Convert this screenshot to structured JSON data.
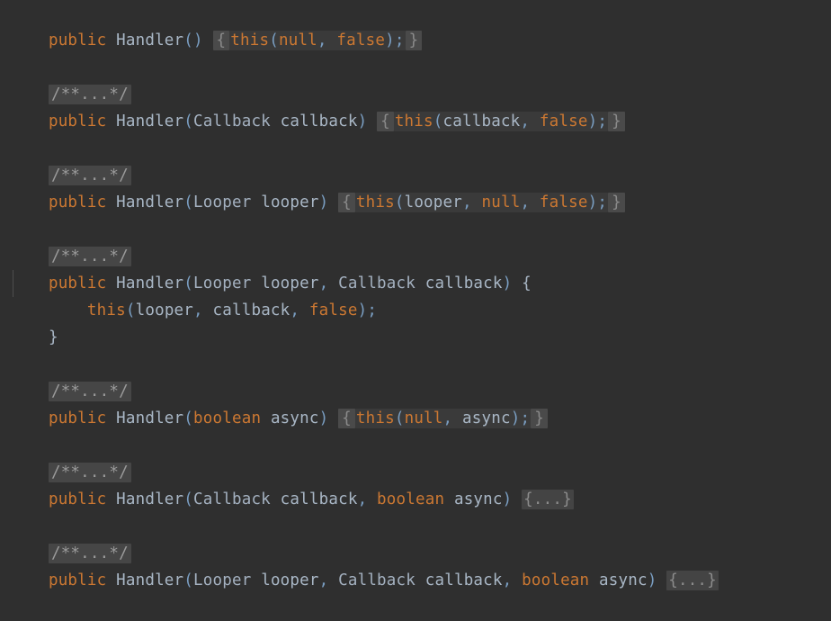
{
  "editor": {
    "language": "java",
    "class_name": "Handler",
    "background_color": "#2f2f2f",
    "colors": {
      "keyword": "#cc7832",
      "identifier": "#a9b7c6",
      "type": "#a4b1c0",
      "punctuation": "#7a9ec2",
      "literal": "#cc7832",
      "fold_background": "#4a4a4a",
      "fold_text": "#8a8a8a",
      "folded_body_background": "#3a3a3a",
      "indent_guide": "#4e4e4e"
    },
    "fold_markers": {
      "javadoc": "/**...*/",
      "body": "{...}",
      "open_brace": "{",
      "close_brace": "}"
    },
    "lines": [
      {
        "n": 1,
        "kind": "code",
        "text": "public Handler() { this(null, false); }",
        "tokens": [
          {
            "t": "public",
            "c": "kw"
          },
          {
            "t": " ",
            "c": "ident"
          },
          {
            "t": "Handler",
            "c": "ident"
          },
          {
            "t": "()",
            "c": "punc"
          },
          {
            "t": " ",
            "c": "ident"
          }
        ],
        "signature": "public Handler()",
        "folded_open": "{",
        "folded_body": "this(null, false);",
        "folded_close": "}"
      },
      {
        "n": 2,
        "kind": "blank",
        "text": ""
      },
      {
        "n": 3,
        "kind": "javadoc-fold",
        "text": "/**...*/"
      },
      {
        "n": 4,
        "kind": "code",
        "text": "public Handler(Callback callback) { this(callback, false); }",
        "signature": "public Handler(Callback callback)",
        "folded_open": "{",
        "folded_body": "this(callback, false);",
        "folded_close": "}"
      },
      {
        "n": 5,
        "kind": "blank",
        "text": ""
      },
      {
        "n": 6,
        "kind": "javadoc-fold",
        "text": "/**...*/"
      },
      {
        "n": 7,
        "kind": "code",
        "text": "public Handler(Looper looper) { this(looper, null, false); }",
        "signature": "public Handler(Looper looper)",
        "folded_open": "{",
        "folded_body": "this(looper, null, false);",
        "folded_close": "}"
      },
      {
        "n": 8,
        "kind": "blank",
        "text": ""
      },
      {
        "n": 9,
        "kind": "javadoc-fold",
        "text": "/**...*/"
      },
      {
        "n": 10,
        "kind": "code-expanded-open",
        "text": "public Handler(Looper looper, Callback callback) {",
        "signature": "public Handler(Looper looper, Callback callback)",
        "open_brace": "{"
      },
      {
        "n": 11,
        "kind": "code-body",
        "text": "    this(looper, callback, false);",
        "body": "this(looper, callback, false);"
      },
      {
        "n": 12,
        "kind": "code-close",
        "text": "}",
        "close_brace": "}"
      },
      {
        "n": 13,
        "kind": "blank",
        "text": ""
      },
      {
        "n": 14,
        "kind": "javadoc-fold",
        "text": "/**...*/"
      },
      {
        "n": 15,
        "kind": "code",
        "text": "public Handler(boolean async) { this(null, async); }",
        "signature": "public Handler(boolean async)",
        "folded_open": "{",
        "folded_body": "this(null, async);",
        "folded_close": "}"
      },
      {
        "n": 16,
        "kind": "blank",
        "text": ""
      },
      {
        "n": 17,
        "kind": "javadoc-fold",
        "text": "/**...*/"
      },
      {
        "n": 18,
        "kind": "code-fold-body",
        "text": "public Handler(Callback callback, boolean async) {...}",
        "signature": "public Handler(Callback callback, boolean async)",
        "folded_body": "{...}"
      },
      {
        "n": 19,
        "kind": "blank",
        "text": ""
      },
      {
        "n": 20,
        "kind": "javadoc-fold",
        "text": "/**...*/"
      },
      {
        "n": 21,
        "kind": "code-fold-body",
        "text": "public Handler(Looper looper, Callback callback, boolean async) {...}",
        "signature": "public Handler(Looper looper, Callback callback, boolean async)",
        "folded_body": "{...}"
      }
    ]
  }
}
